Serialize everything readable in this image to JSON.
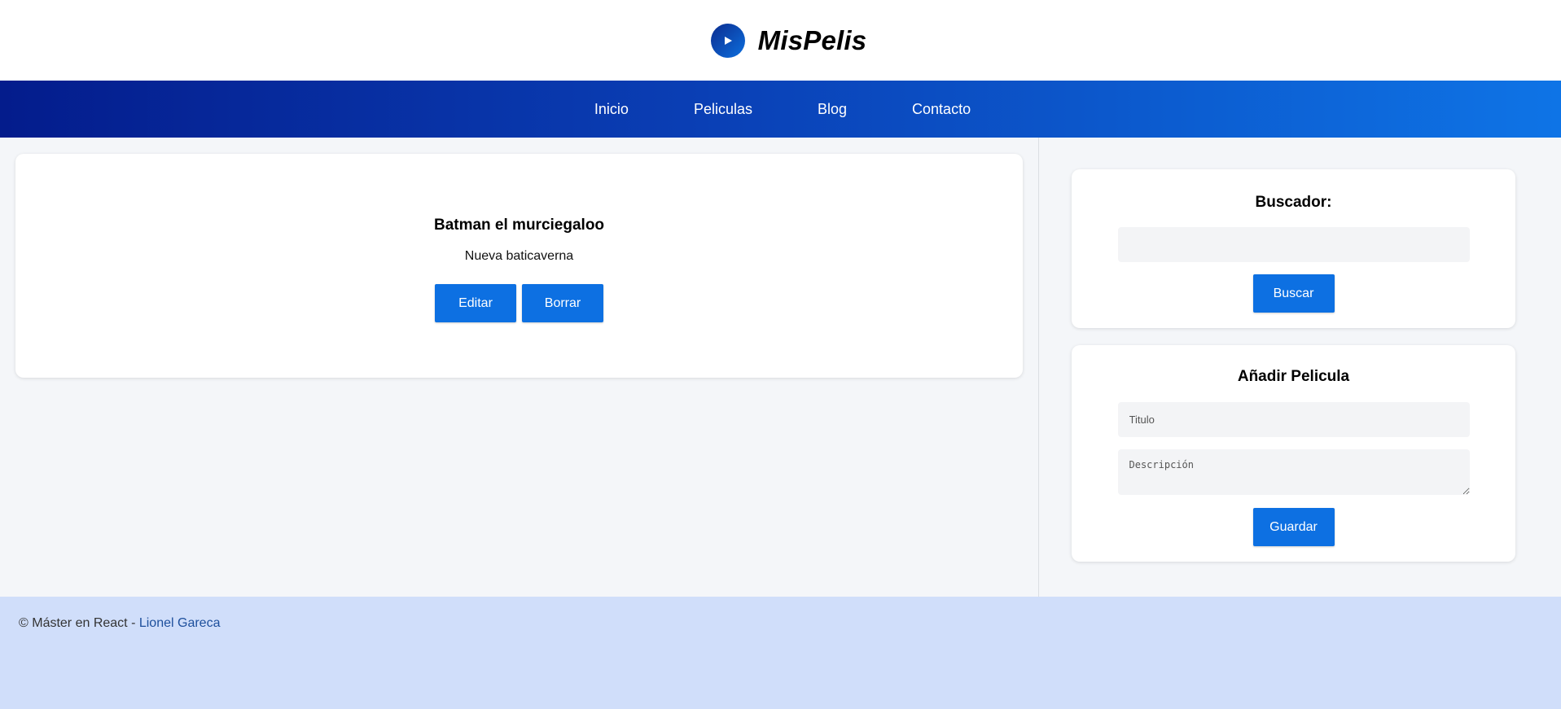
{
  "brand": {
    "name": "MisPelis",
    "icon": "play-icon"
  },
  "nav": {
    "items": [
      {
        "label": "Inicio"
      },
      {
        "label": "Peliculas"
      },
      {
        "label": "Blog"
      },
      {
        "label": "Contacto"
      }
    ]
  },
  "movie": {
    "title": "Batman el murciegaloo",
    "description": "Nueva baticaverna",
    "edit_label": "Editar",
    "delete_label": "Borrar"
  },
  "search": {
    "title": "Buscador:",
    "value": "",
    "button_label": "Buscar"
  },
  "add": {
    "title": "Añadir Pelicula",
    "title_placeholder": "Titulo",
    "description_placeholder": "Descripción",
    "button_label": "Guardar"
  },
  "footer": {
    "text": "© Máster en React - ",
    "author": "Lionel Gareca"
  },
  "colors": {
    "primary": "#0d70e2",
    "nav_start": "#041c8c",
    "nav_end": "#0e74e6",
    "footer_bg": "#d0defa"
  }
}
